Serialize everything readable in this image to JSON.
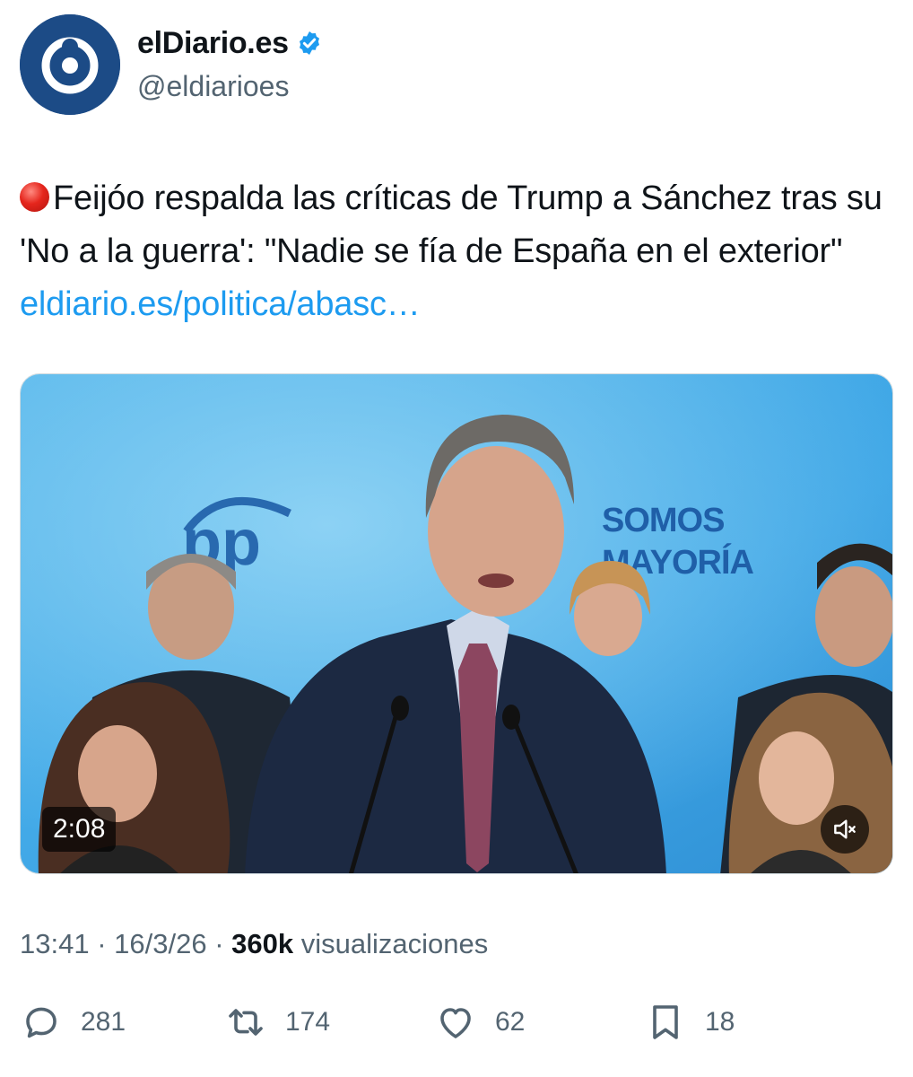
{
  "author": {
    "display_name": "elDiario.es",
    "handle": "@eldiarioes",
    "verified": true,
    "avatar_color": "#1c4b86"
  },
  "tweet": {
    "text": "Feijóo respalda las críticas de Trump a Sánchez tras su 'No a la guerra': \"Nadie se fía de España en el exterior\"",
    "link": "eldiario.es/politica/abasc…",
    "link_color": "#1d9bf0",
    "status_icon": "red-circle-emoji"
  },
  "media": {
    "duration": "2:08",
    "muted": true,
    "backdrop_logo": "pp",
    "backdrop_slogan_line1": "SOMOS",
    "backdrop_slogan_line2": "MAYORÍA"
  },
  "meta": {
    "time": "13:41",
    "date": "16/3/26",
    "views": "360k",
    "views_label": "visualizaciones",
    "separator": "·"
  },
  "actions": {
    "replies": "281",
    "retweets": "174",
    "likes": "62",
    "bookmarks": "18"
  }
}
